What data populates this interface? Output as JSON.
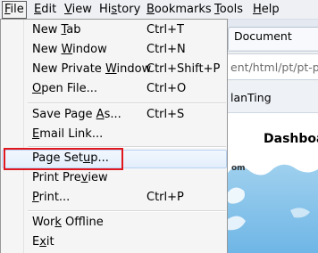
{
  "menubar": {
    "items": [
      {
        "label": "File",
        "mnemonic": "F",
        "rest": "ile"
      },
      {
        "label": "Edit",
        "mnemonic": "E",
        "rest": "dit"
      },
      {
        "label": "View",
        "mnemonic": "V",
        "rest": "iew"
      },
      {
        "label": "History",
        "pre": "Hi",
        "mnemonic": "s",
        "rest": "tory"
      },
      {
        "label": "Bookmarks",
        "mnemonic": "B",
        "rest": "ookmarks"
      },
      {
        "label": "Tools",
        "mnemonic": "T",
        "rest": "ools"
      },
      {
        "label": "Help",
        "mnemonic": "H",
        "rest": "elp"
      }
    ]
  },
  "file_menu": {
    "new_tab": {
      "pre": "New ",
      "mnemonic": "T",
      "rest": "ab",
      "shortcut": "Ctrl+T"
    },
    "new_window": {
      "pre": "New ",
      "mnemonic": "W",
      "rest": "indow",
      "shortcut": "Ctrl+N"
    },
    "new_private_window": {
      "pre": "New Private ",
      "mnemonic": "W",
      "rest": "indow",
      "shortcut": "Ctrl+Shift+P"
    },
    "open_file": {
      "pre": "",
      "mnemonic": "O",
      "rest": "pen File...",
      "shortcut": "Ctrl+O"
    },
    "save_page_as": {
      "pre": "Save Page ",
      "mnemonic": "A",
      "rest": "s...",
      "shortcut": "Ctrl+S"
    },
    "email_link": {
      "pre": "",
      "mnemonic": "E",
      "rest": "mail Link...",
      "shortcut": ""
    },
    "page_setup": {
      "pre": "Page Set",
      "mnemonic": "u",
      "rest": "p...",
      "shortcut": ""
    },
    "print_preview": {
      "pre": "Print Pre",
      "mnemonic": "v",
      "rest": "iew",
      "shortcut": ""
    },
    "print": {
      "pre": "",
      "mnemonic": "P",
      "rest": "rint...",
      "shortcut": "Ctrl+P"
    },
    "work_offline": {
      "pre": "Wor",
      "mnemonic": "k",
      "rest": " Offline",
      "shortcut": ""
    },
    "exit": {
      "pre": "E",
      "mnemonic": "x",
      "rest": "it",
      "shortcut": ""
    }
  },
  "background": {
    "tab_title": "Document",
    "url_fragment": "ent/html/pt/pt-pre",
    "bookmark_fragment": "lanTing",
    "page_heading": "Dashboa",
    "page_small": "om"
  },
  "colors": {
    "highlight_border": "#e0181e",
    "menu_bg": "#f5f5f5",
    "hover_bg": "#e3eefb"
  }
}
